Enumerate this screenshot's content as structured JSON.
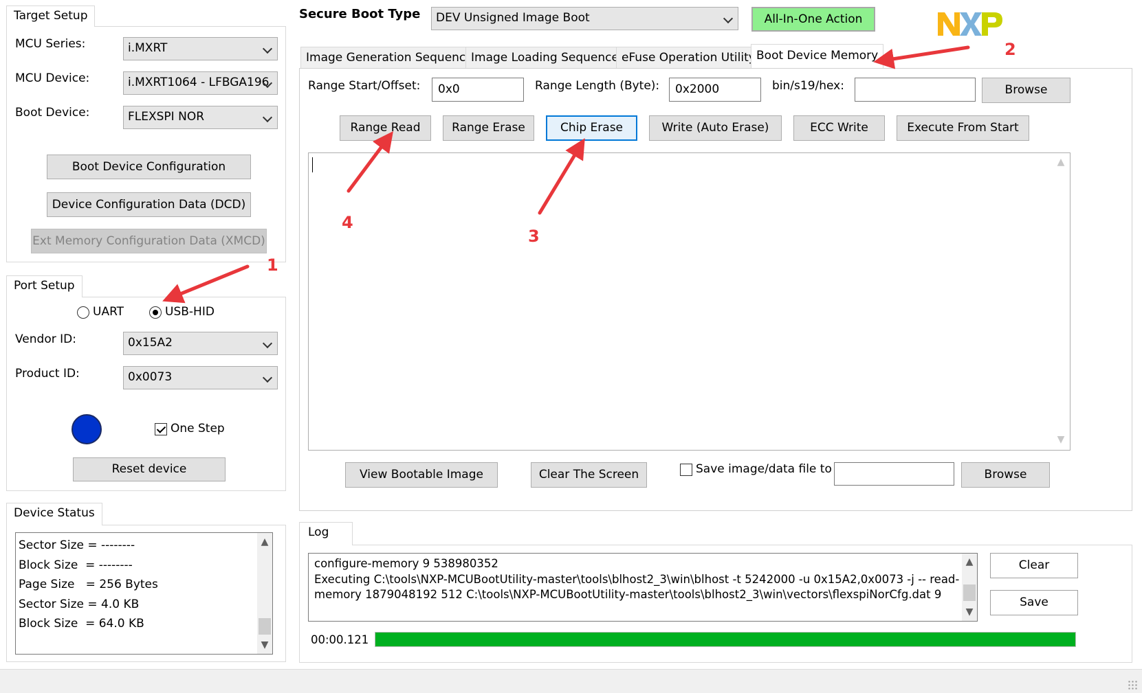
{
  "target_setup": {
    "title": "Target Setup",
    "mcu_series_label": "MCU Series:",
    "mcu_series_value": "i.MXRT",
    "mcu_device_label": "MCU Device:",
    "mcu_device_value": "i.MXRT1064 - LFBGA196",
    "boot_device_label": "Boot Device:",
    "boot_device_value": "FLEXSPI NOR",
    "boot_device_config": "Boot Device Configuration",
    "dcd": "Device Configuration Data (DCD)",
    "xmcd": "Ext Memory Configuration Data (XMCD)"
  },
  "port_setup": {
    "title": "Port Setup",
    "uart_label": "UART",
    "usbhid_label": "USB-HID",
    "selected": "USB-HID",
    "vendor_id_label": "Vendor ID:",
    "vendor_id_value": "0x15A2",
    "product_id_label": "Product ID:",
    "product_id_value": "0x0073",
    "one_step_label": "One Step",
    "one_step_checked": true,
    "reset_label": "Reset device",
    "status_color": "#0033cc"
  },
  "device_status": {
    "title": "Device Status",
    "lines": [
      "Sector Size = --------",
      "Block Size  = --------",
      "Page Size   = 256 Bytes",
      "Sector Size = 4.0 KB",
      "Block Size  = 64.0 KB"
    ]
  },
  "header": {
    "secure_boot_label": "Secure Boot Type",
    "secure_boot_value": "DEV Unsigned Image Boot",
    "all_in_one": "All-In-One Action",
    "logo_text": "NXP"
  },
  "tabs": [
    {
      "label": "Image Generation Sequence",
      "selected": false
    },
    {
      "label": "Image Loading Sequence",
      "selected": false
    },
    {
      "label": "eFuse Operation Utility",
      "selected": false
    },
    {
      "label": "Boot Device Memory",
      "selected": true
    }
  ],
  "memory": {
    "range_start_label": "Range Start/Offset:",
    "range_start_value": "0x0",
    "range_length_label": "Range Length (Byte):",
    "range_length_value": "0x2000",
    "file_label": "bin/s19/hex:",
    "file_value": "",
    "browse": "Browse",
    "buttons": [
      "Range Read",
      "Range Erase",
      "Chip Erase",
      "Write (Auto Erase)",
      "ECC Write",
      "Execute From Start"
    ],
    "view_bootable": "View Bootable Image",
    "clear_screen": "Clear The Screen",
    "save_file_label": "Save image/data file to",
    "save_file_checked": false,
    "save_file_value": "",
    "browse2": "Browse"
  },
  "log": {
    "title": "Log",
    "lines": [
      "configure-memory 9 538980352",
      "Executing C:\\tools\\NXP-MCUBootUtility-master\\tools\\blhost2_3\\win\\blhost -t 5242000 -u 0x15A2,0x0073 -j -- read-",
      "memory 1879048192 512 C:\\tools\\NXP-MCUBootUtility-master\\tools\\blhost2_3\\win\\vectors\\flexspiNorCfg.dat 9"
    ],
    "clear": "Clear",
    "save": "Save",
    "elapsed": "00:00.121",
    "progress": 1.0,
    "progress_color": "#00b020"
  },
  "annotations": [
    "1",
    "2",
    "3",
    "4"
  ],
  "colors": {
    "annotation": "#e8373b",
    "all_in_one_bg": "#8ef08e",
    "focus": "#0078d7"
  }
}
